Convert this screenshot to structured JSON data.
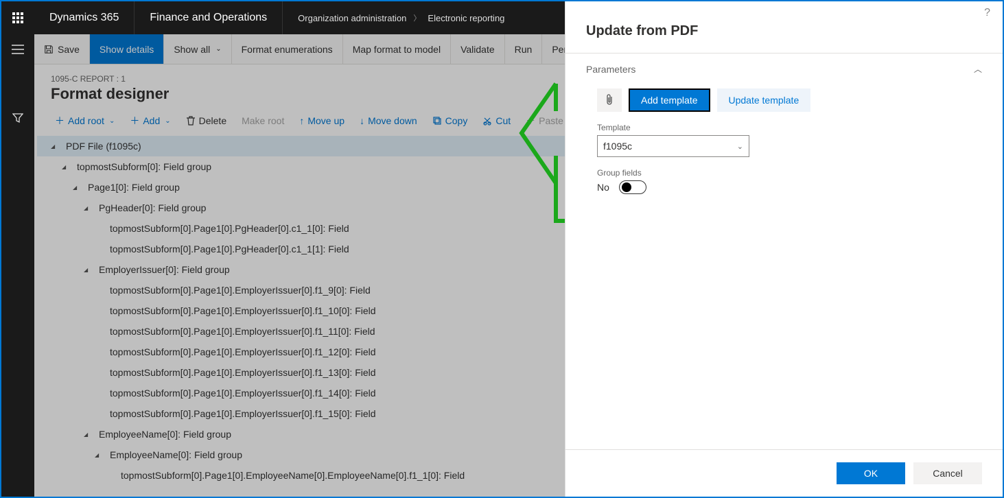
{
  "topbar": {
    "brand": "Dynamics 365",
    "module": "Finance and Operations",
    "breadcrumb": [
      "Organization administration",
      "Electronic reporting"
    ]
  },
  "actionbar": {
    "save": "Save",
    "show_details": "Show details",
    "show_all": "Show all",
    "format_enum": "Format enumerations",
    "map_format": "Map format to model",
    "validate": "Validate",
    "run": "Run",
    "performance": "Performance"
  },
  "page": {
    "context": "1095-C REPORT : 1",
    "title": "Format designer"
  },
  "tools": {
    "add_root": "Add root",
    "add": "Add",
    "delete": "Delete",
    "make_root": "Make root",
    "move_up": "Move up",
    "move_down": "Move down",
    "copy": "Copy",
    "cut": "Cut",
    "paste": "Paste"
  },
  "tree": [
    {
      "indent": 0,
      "caret": true,
      "label": "PDF File (f1095c)",
      "selected": true
    },
    {
      "indent": 1,
      "caret": true,
      "label": "topmostSubform[0]: Field group"
    },
    {
      "indent": 2,
      "caret": true,
      "label": "Page1[0]: Field group"
    },
    {
      "indent": 3,
      "caret": true,
      "label": "PgHeader[0]: Field group"
    },
    {
      "indent": 4,
      "caret": false,
      "label": "topmostSubform[0].Page1[0].PgHeader[0].c1_1[0]: Field"
    },
    {
      "indent": 4,
      "caret": false,
      "label": "topmostSubform[0].Page1[0].PgHeader[0].c1_1[1]: Field"
    },
    {
      "indent": 3,
      "caret": true,
      "label": "EmployerIssuer[0]: Field group"
    },
    {
      "indent": 4,
      "caret": false,
      "label": "topmostSubform[0].Page1[0].EmployerIssuer[0].f1_9[0]: Field"
    },
    {
      "indent": 4,
      "caret": false,
      "label": "topmostSubform[0].Page1[0].EmployerIssuer[0].f1_10[0]: Field"
    },
    {
      "indent": 4,
      "caret": false,
      "label": "topmostSubform[0].Page1[0].EmployerIssuer[0].f1_11[0]: Field"
    },
    {
      "indent": 4,
      "caret": false,
      "label": "topmostSubform[0].Page1[0].EmployerIssuer[0].f1_12[0]: Field"
    },
    {
      "indent": 4,
      "caret": false,
      "label": "topmostSubform[0].Page1[0].EmployerIssuer[0].f1_13[0]: Field"
    },
    {
      "indent": 4,
      "caret": false,
      "label": "topmostSubform[0].Page1[0].EmployerIssuer[0].f1_14[0]: Field"
    },
    {
      "indent": 4,
      "caret": false,
      "label": "topmostSubform[0].Page1[0].EmployerIssuer[0].f1_15[0]: Field"
    },
    {
      "indent": 3,
      "caret": true,
      "label": "EmployeeName[0]: Field group"
    },
    {
      "indent": 4,
      "caret": true,
      "label": "EmployeeName[0]: Field group"
    },
    {
      "indent": 5,
      "caret": false,
      "label": "topmostSubform[0].Page1[0].EmployeeName[0].EmployeeName[0].f1_1[0]: Field"
    }
  ],
  "panel": {
    "title": "Update from PDF",
    "section": "Parameters",
    "add_template": "Add template",
    "update_template": "Update template",
    "template_label": "Template",
    "template_value": "f1095c",
    "group_fields_label": "Group fields",
    "group_fields_value": "No",
    "ok": "OK",
    "cancel": "Cancel"
  }
}
